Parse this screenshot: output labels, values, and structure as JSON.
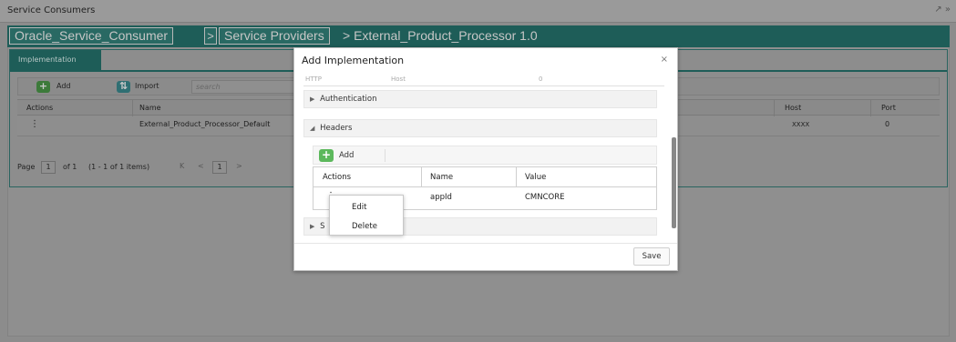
{
  "app": {
    "title": "Service Consumers",
    "window_icons": "↗ »"
  },
  "breadcrumb": {
    "consumer": "Oracle_Service_Consumer",
    "sep1": ">",
    "providers": "Service Providers",
    "sep2": ">",
    "current": "> External_Product_Processor 1.0"
  },
  "panel": {
    "tab_label": "Implementation",
    "toolbar": {
      "add_label": "Add",
      "import_label": "Import",
      "search_placeholder": "search"
    },
    "grid": {
      "columns": [
        "Actions",
        "Name",
        "Host",
        "Port"
      ],
      "rows": [
        {
          "actions": "⋮",
          "name": "External_Product_Processor_Default",
          "host": "XXXX",
          "port": "0"
        }
      ]
    },
    "pager": {
      "page_label": "Page",
      "page_value": "1",
      "of_label": "of 1",
      "items_label": "(1 - 1 of 1 items)",
      "first": "K",
      "prev": "<",
      "current": "1",
      "next": ">"
    }
  },
  "modal": {
    "title": "Add Implementation",
    "close": "×",
    "cut_row": [
      "HTTP",
      "Host",
      "0"
    ],
    "authentication_label": "Authentication",
    "headers_label": "Headers",
    "add_label": "Add",
    "headers_table": {
      "columns": [
        "Actions",
        "Name",
        "Value"
      ],
      "rows": [
        {
          "actions": "⋮",
          "name": "appId",
          "value": "CMNCORE"
        }
      ]
    },
    "partial_section_label": "S",
    "save_label": "Save"
  },
  "context_menu": {
    "items": [
      "Edit",
      "Delete"
    ]
  },
  "colors": {
    "brand_teal": "#1e5d58",
    "add_green": "#5cb85c"
  }
}
